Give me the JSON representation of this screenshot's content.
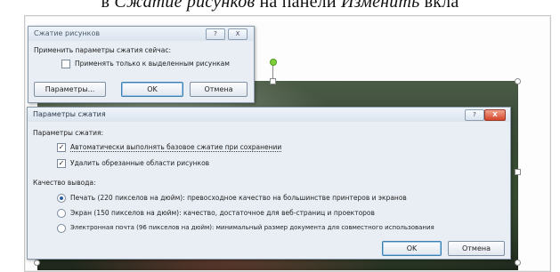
{
  "document": {
    "line_prefix": "в ",
    "line_italic_1": "Сжатие рисунков",
    "line_middle": " на панели ",
    "line_italic_2": "Изменить",
    "line_suffix": " вкла"
  },
  "compress_dialog": {
    "title": "Сжатие рисунков",
    "help_label": "?",
    "close_label": "X",
    "apply_now_label": "Применить параметры сжатия сейчас:",
    "selected_only_label": "Применять только к выделенным рисункам",
    "selected_only_checked": false,
    "params_button": "Параметры...",
    "ok_button": "OK",
    "cancel_button": "Отмена"
  },
  "settings_dialog": {
    "title": "Параметры сжатия",
    "help_label": "?",
    "close_label": "X",
    "compress_group_label": "Параметры сжатия:",
    "auto_compress_label": "Автоматически выполнять базовое сжатие при сохранении",
    "auto_compress_checked": true,
    "delete_cropped_label": "Удалить обрезанные области рисунков",
    "delete_cropped_checked": true,
    "output_group_label": "Качество вывода:",
    "options": [
      {
        "label": "Печать (220 пикселов на дюйм): превосходное качество на большинстве принтеров и экранов",
        "selected": true
      },
      {
        "label": "Экран (150 пикселов на дюйм): качество, достаточное для веб-страниц и проекторов",
        "selected": false
      },
      {
        "label": "Электронная почта (96 пикселов на дюйм): минимальный размер документа для совместного использования",
        "selected": false
      }
    ],
    "ok_button": "OK",
    "cancel_button": "Отмена"
  }
}
